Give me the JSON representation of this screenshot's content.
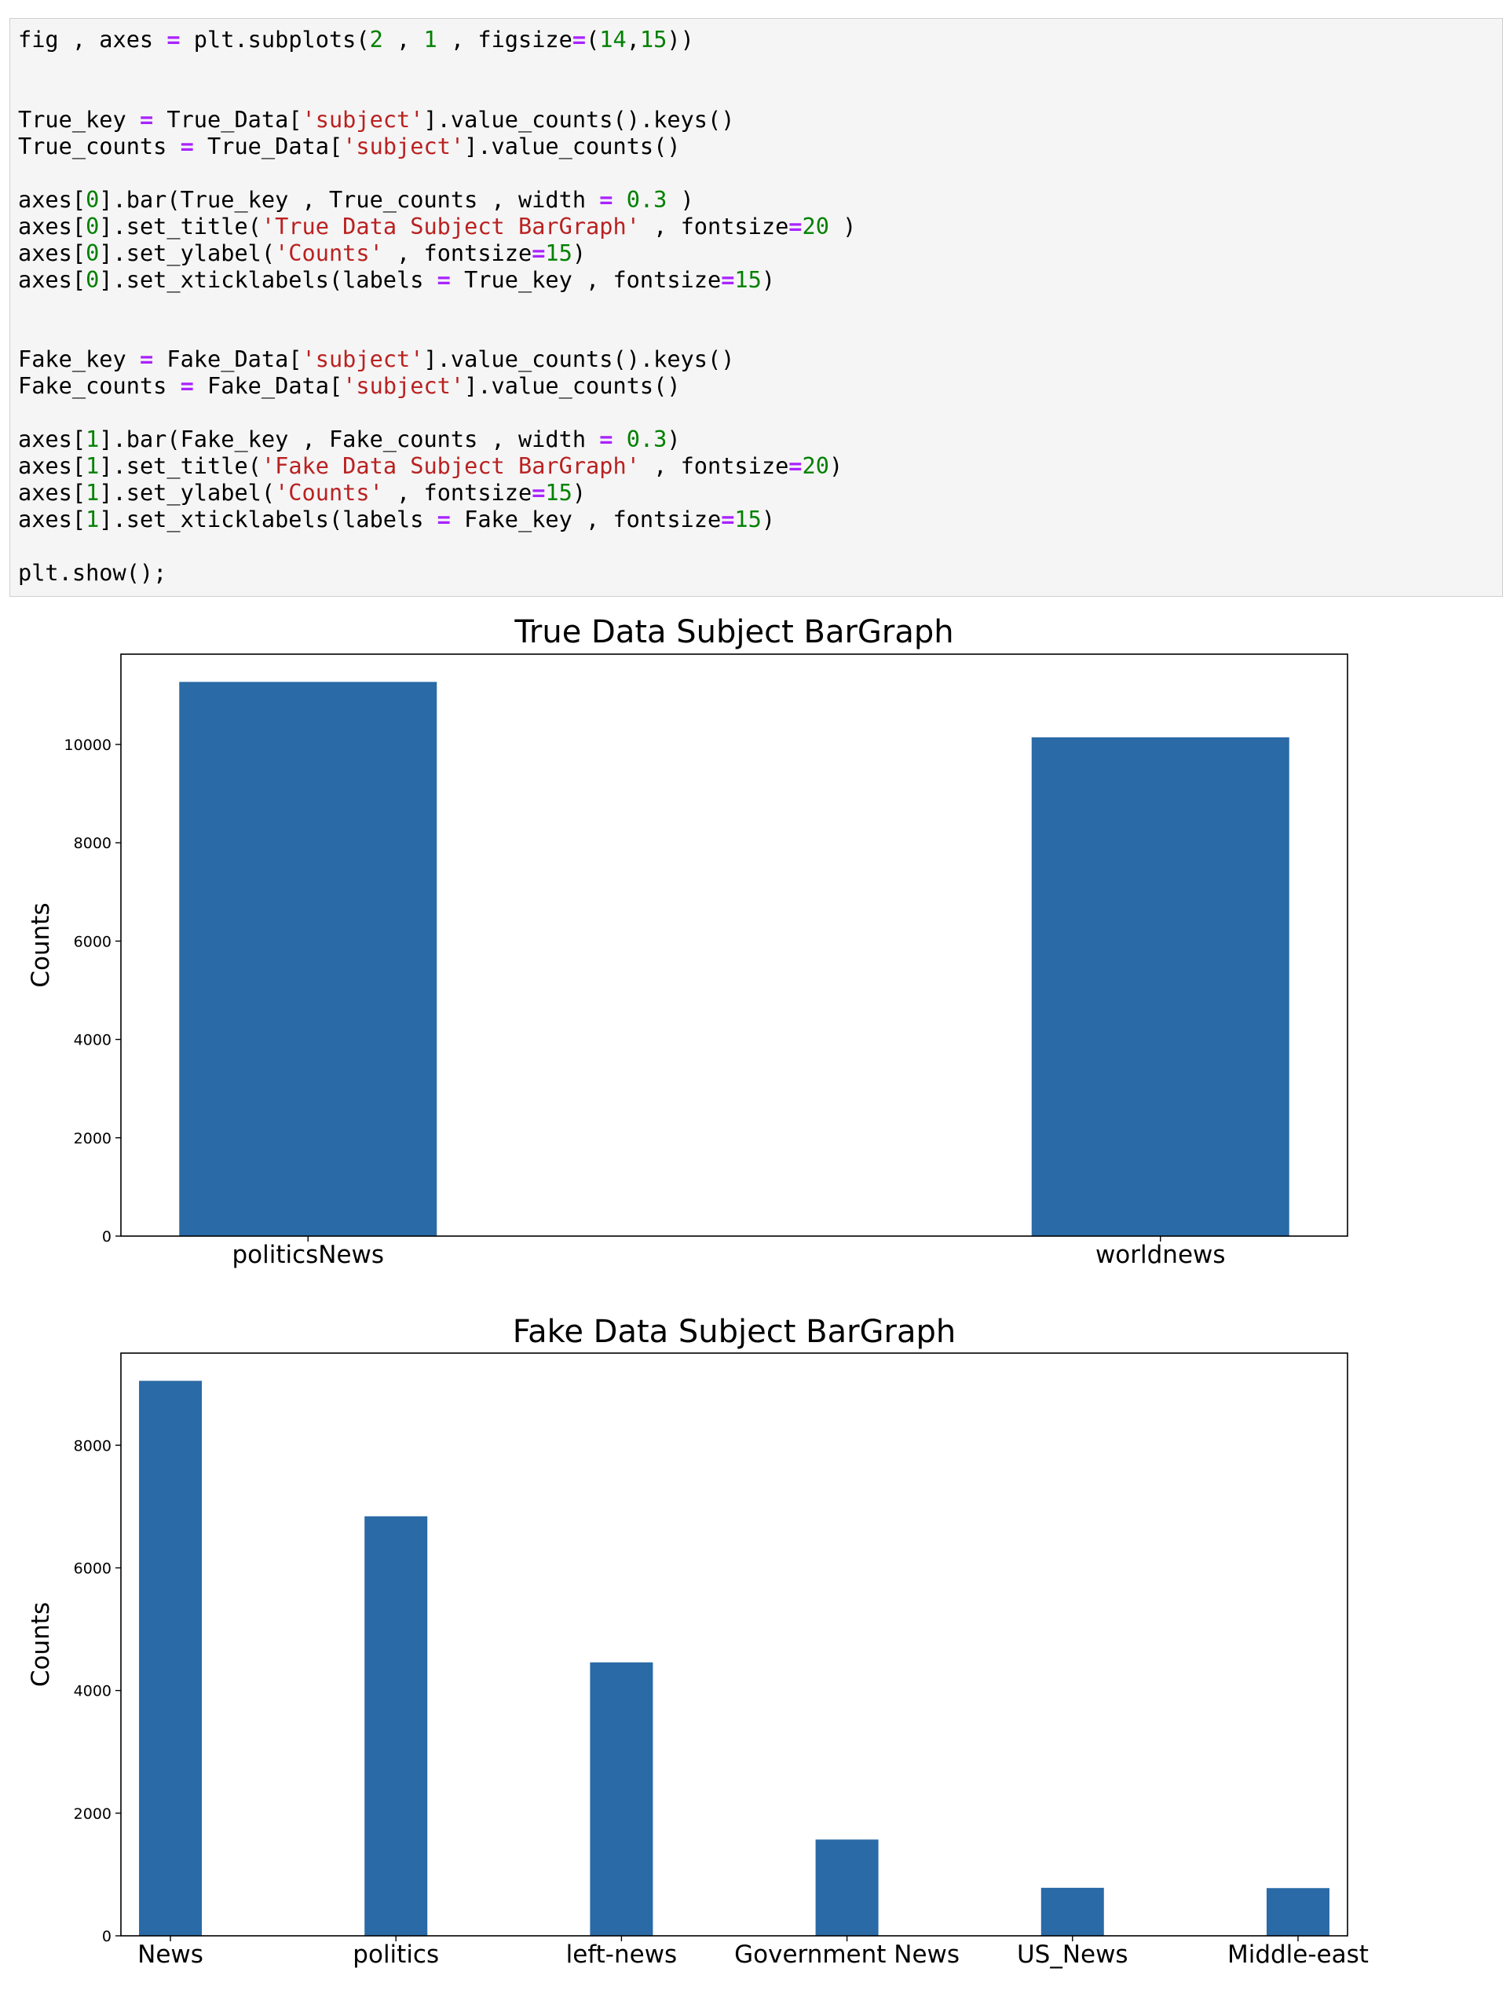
{
  "code_lines": [
    [
      [
        "fig , axes ",
        ""
      ],
      [
        "=",
        "op"
      ],
      [
        " plt.subplots(",
        ""
      ],
      [
        "2",
        "num"
      ],
      [
        " , ",
        ""
      ],
      [
        "1",
        "num"
      ],
      [
        " , figsize",
        ""
      ],
      [
        "=",
        "op"
      ],
      [
        "(",
        ""
      ],
      [
        "14",
        "num"
      ],
      [
        ",",
        ""
      ],
      [
        "15",
        "num"
      ],
      [
        "))",
        ""
      ]
    ],
    [],
    [],
    [
      [
        "True_key ",
        ""
      ],
      [
        "=",
        "op"
      ],
      [
        " True_Data[",
        ""
      ],
      [
        "'subject'",
        "str"
      ],
      [
        "].value_counts().keys()",
        ""
      ]
    ],
    [
      [
        "True_counts ",
        ""
      ],
      [
        "=",
        "op"
      ],
      [
        " True_Data[",
        ""
      ],
      [
        "'subject'",
        "str"
      ],
      [
        "].value_counts()",
        ""
      ]
    ],
    [],
    [
      [
        "axes[",
        ""
      ],
      [
        "0",
        "num"
      ],
      [
        "].bar(True_key , True_counts , width ",
        ""
      ],
      [
        "=",
        "op"
      ],
      [
        " ",
        ""
      ],
      [
        "0.3",
        "num"
      ],
      [
        " )",
        ""
      ]
    ],
    [
      [
        "axes[",
        ""
      ],
      [
        "0",
        "num"
      ],
      [
        "].set_title(",
        ""
      ],
      [
        "'True Data Subject BarGraph'",
        "str"
      ],
      [
        " , fontsize",
        ""
      ],
      [
        "=",
        "op"
      ],
      [
        "20",
        "num"
      ],
      [
        " )",
        ""
      ]
    ],
    [
      [
        "axes[",
        ""
      ],
      [
        "0",
        "num"
      ],
      [
        "].set_ylabel(",
        ""
      ],
      [
        "'Counts'",
        "str"
      ],
      [
        " , fontsize",
        ""
      ],
      [
        "=",
        "op"
      ],
      [
        "15",
        "num"
      ],
      [
        ")",
        ""
      ]
    ],
    [
      [
        "axes[",
        ""
      ],
      [
        "0",
        "num"
      ],
      [
        "].set_xticklabels(labels ",
        ""
      ],
      [
        "=",
        "op"
      ],
      [
        " True_key , fontsize",
        ""
      ],
      [
        "=",
        "op"
      ],
      [
        "15",
        "num"
      ],
      [
        ")",
        ""
      ]
    ],
    [],
    [],
    [
      [
        "Fake_key ",
        ""
      ],
      [
        "=",
        "op"
      ],
      [
        " Fake_Data[",
        ""
      ],
      [
        "'subject'",
        "str"
      ],
      [
        "].value_counts().keys()",
        ""
      ]
    ],
    [
      [
        "Fake_counts ",
        ""
      ],
      [
        "=",
        "op"
      ],
      [
        " Fake_Data[",
        ""
      ],
      [
        "'subject'",
        "str"
      ],
      [
        "].value_counts()",
        ""
      ]
    ],
    [],
    [
      [
        "axes[",
        ""
      ],
      [
        "1",
        "num"
      ],
      [
        "].bar(Fake_key , Fake_counts , width ",
        ""
      ],
      [
        "=",
        "op"
      ],
      [
        " ",
        ""
      ],
      [
        "0.3",
        "num"
      ],
      [
        ")",
        ""
      ]
    ],
    [
      [
        "axes[",
        ""
      ],
      [
        "1",
        "num"
      ],
      [
        "].set_title(",
        ""
      ],
      [
        "'Fake Data Subject BarGraph'",
        "str"
      ],
      [
        " , fontsize",
        ""
      ],
      [
        "=",
        "op"
      ],
      [
        "20",
        "num"
      ],
      [
        ")",
        ""
      ]
    ],
    [
      [
        "axes[",
        ""
      ],
      [
        "1",
        "num"
      ],
      [
        "].set_ylabel(",
        ""
      ],
      [
        "'Counts'",
        "str"
      ],
      [
        " , fontsize",
        ""
      ],
      [
        "=",
        "op"
      ],
      [
        "15",
        "num"
      ],
      [
        ")",
        ""
      ]
    ],
    [
      [
        "axes[",
        ""
      ],
      [
        "1",
        "num"
      ],
      [
        "].set_xticklabels(labels ",
        ""
      ],
      [
        "=",
        "op"
      ],
      [
        " Fake_key , fontsize",
        ""
      ],
      [
        "=",
        "op"
      ],
      [
        "15",
        "num"
      ],
      [
        ")",
        ""
      ]
    ],
    [],
    [
      [
        "plt.show();",
        ""
      ]
    ]
  ],
  "chart_data": [
    {
      "type": "bar",
      "title": "True Data Subject BarGraph",
      "xlabel": "",
      "ylabel": "Counts",
      "categories": [
        "politicsNews",
        "worldnews"
      ],
      "values": [
        11272,
        10145
      ],
      "ylim": [
        0,
        11836
      ],
      "yticks": [
        0,
        2000,
        4000,
        6000,
        8000,
        10000
      ],
      "bar_color": "#2a6aa6",
      "grid": false
    },
    {
      "type": "bar",
      "title": "Fake Data Subject BarGraph",
      "xlabel": "",
      "ylabel": "Counts",
      "categories": [
        "News",
        "politics",
        "left-news",
        "Government News",
        "US_News",
        "Middle-east"
      ],
      "values": [
        9050,
        6841,
        4459,
        1570,
        783,
        778
      ],
      "ylim": [
        0,
        9502
      ],
      "yticks": [
        0,
        2000,
        4000,
        6000,
        8000
      ],
      "bar_color": "#2a6aa6",
      "grid": false
    }
  ]
}
